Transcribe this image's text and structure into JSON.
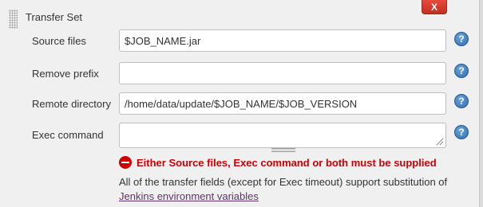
{
  "transfer_set": {
    "title": "Transfer Set",
    "delete_label": "X"
  },
  "fields": {
    "source_files": {
      "label": "Source files",
      "value": "$JOB_NAME.jar"
    },
    "remove_prefix": {
      "label": "Remove prefix",
      "value": ""
    },
    "remote_directory": {
      "label": "Remote directory",
      "value": "/home/data/update/$JOB_NAME/$JOB_VERSION"
    },
    "exec_command": {
      "label": "Exec command",
      "value": ""
    }
  },
  "help_label": "?",
  "error": {
    "message": "Either Source files, Exec command or both must be supplied"
  },
  "info": {
    "text": "All of the transfer fields (except for Exec timeout) support substitution of",
    "link": "Jenkins environment variables"
  },
  "colors": {
    "error": "#cc0000",
    "link": "#5c3566",
    "delete_button": "#d33a2b",
    "help_icon": "#2f6fb0"
  }
}
